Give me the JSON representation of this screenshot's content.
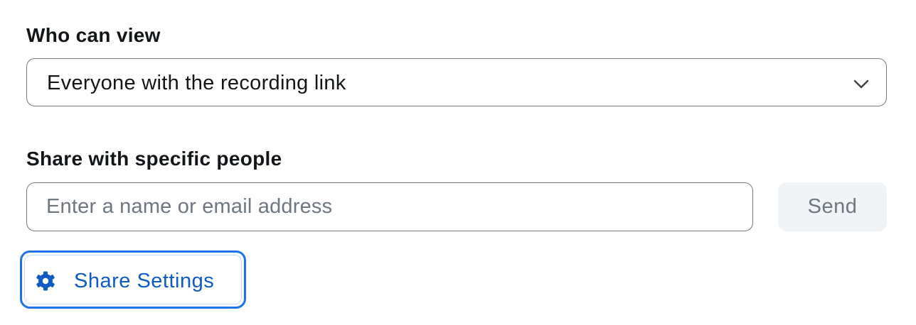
{
  "view_section": {
    "label": "Who can view",
    "selected_option": "Everyone with the recording link",
    "dropdown_icon": "chevron-down-icon"
  },
  "share_section": {
    "label": "Share with specific people",
    "input_value": "",
    "input_placeholder": "Enter a name or email address",
    "send_label": "Send"
  },
  "settings_button": {
    "label": "Share Settings",
    "icon": "gear-icon"
  },
  "colors": {
    "accent": "#1d73e8",
    "accent_text": "#0e5bc1",
    "border": "#747b82",
    "disabled_bg": "#f1f4f6",
    "disabled_text": "#6e7680",
    "text": "#131619"
  }
}
